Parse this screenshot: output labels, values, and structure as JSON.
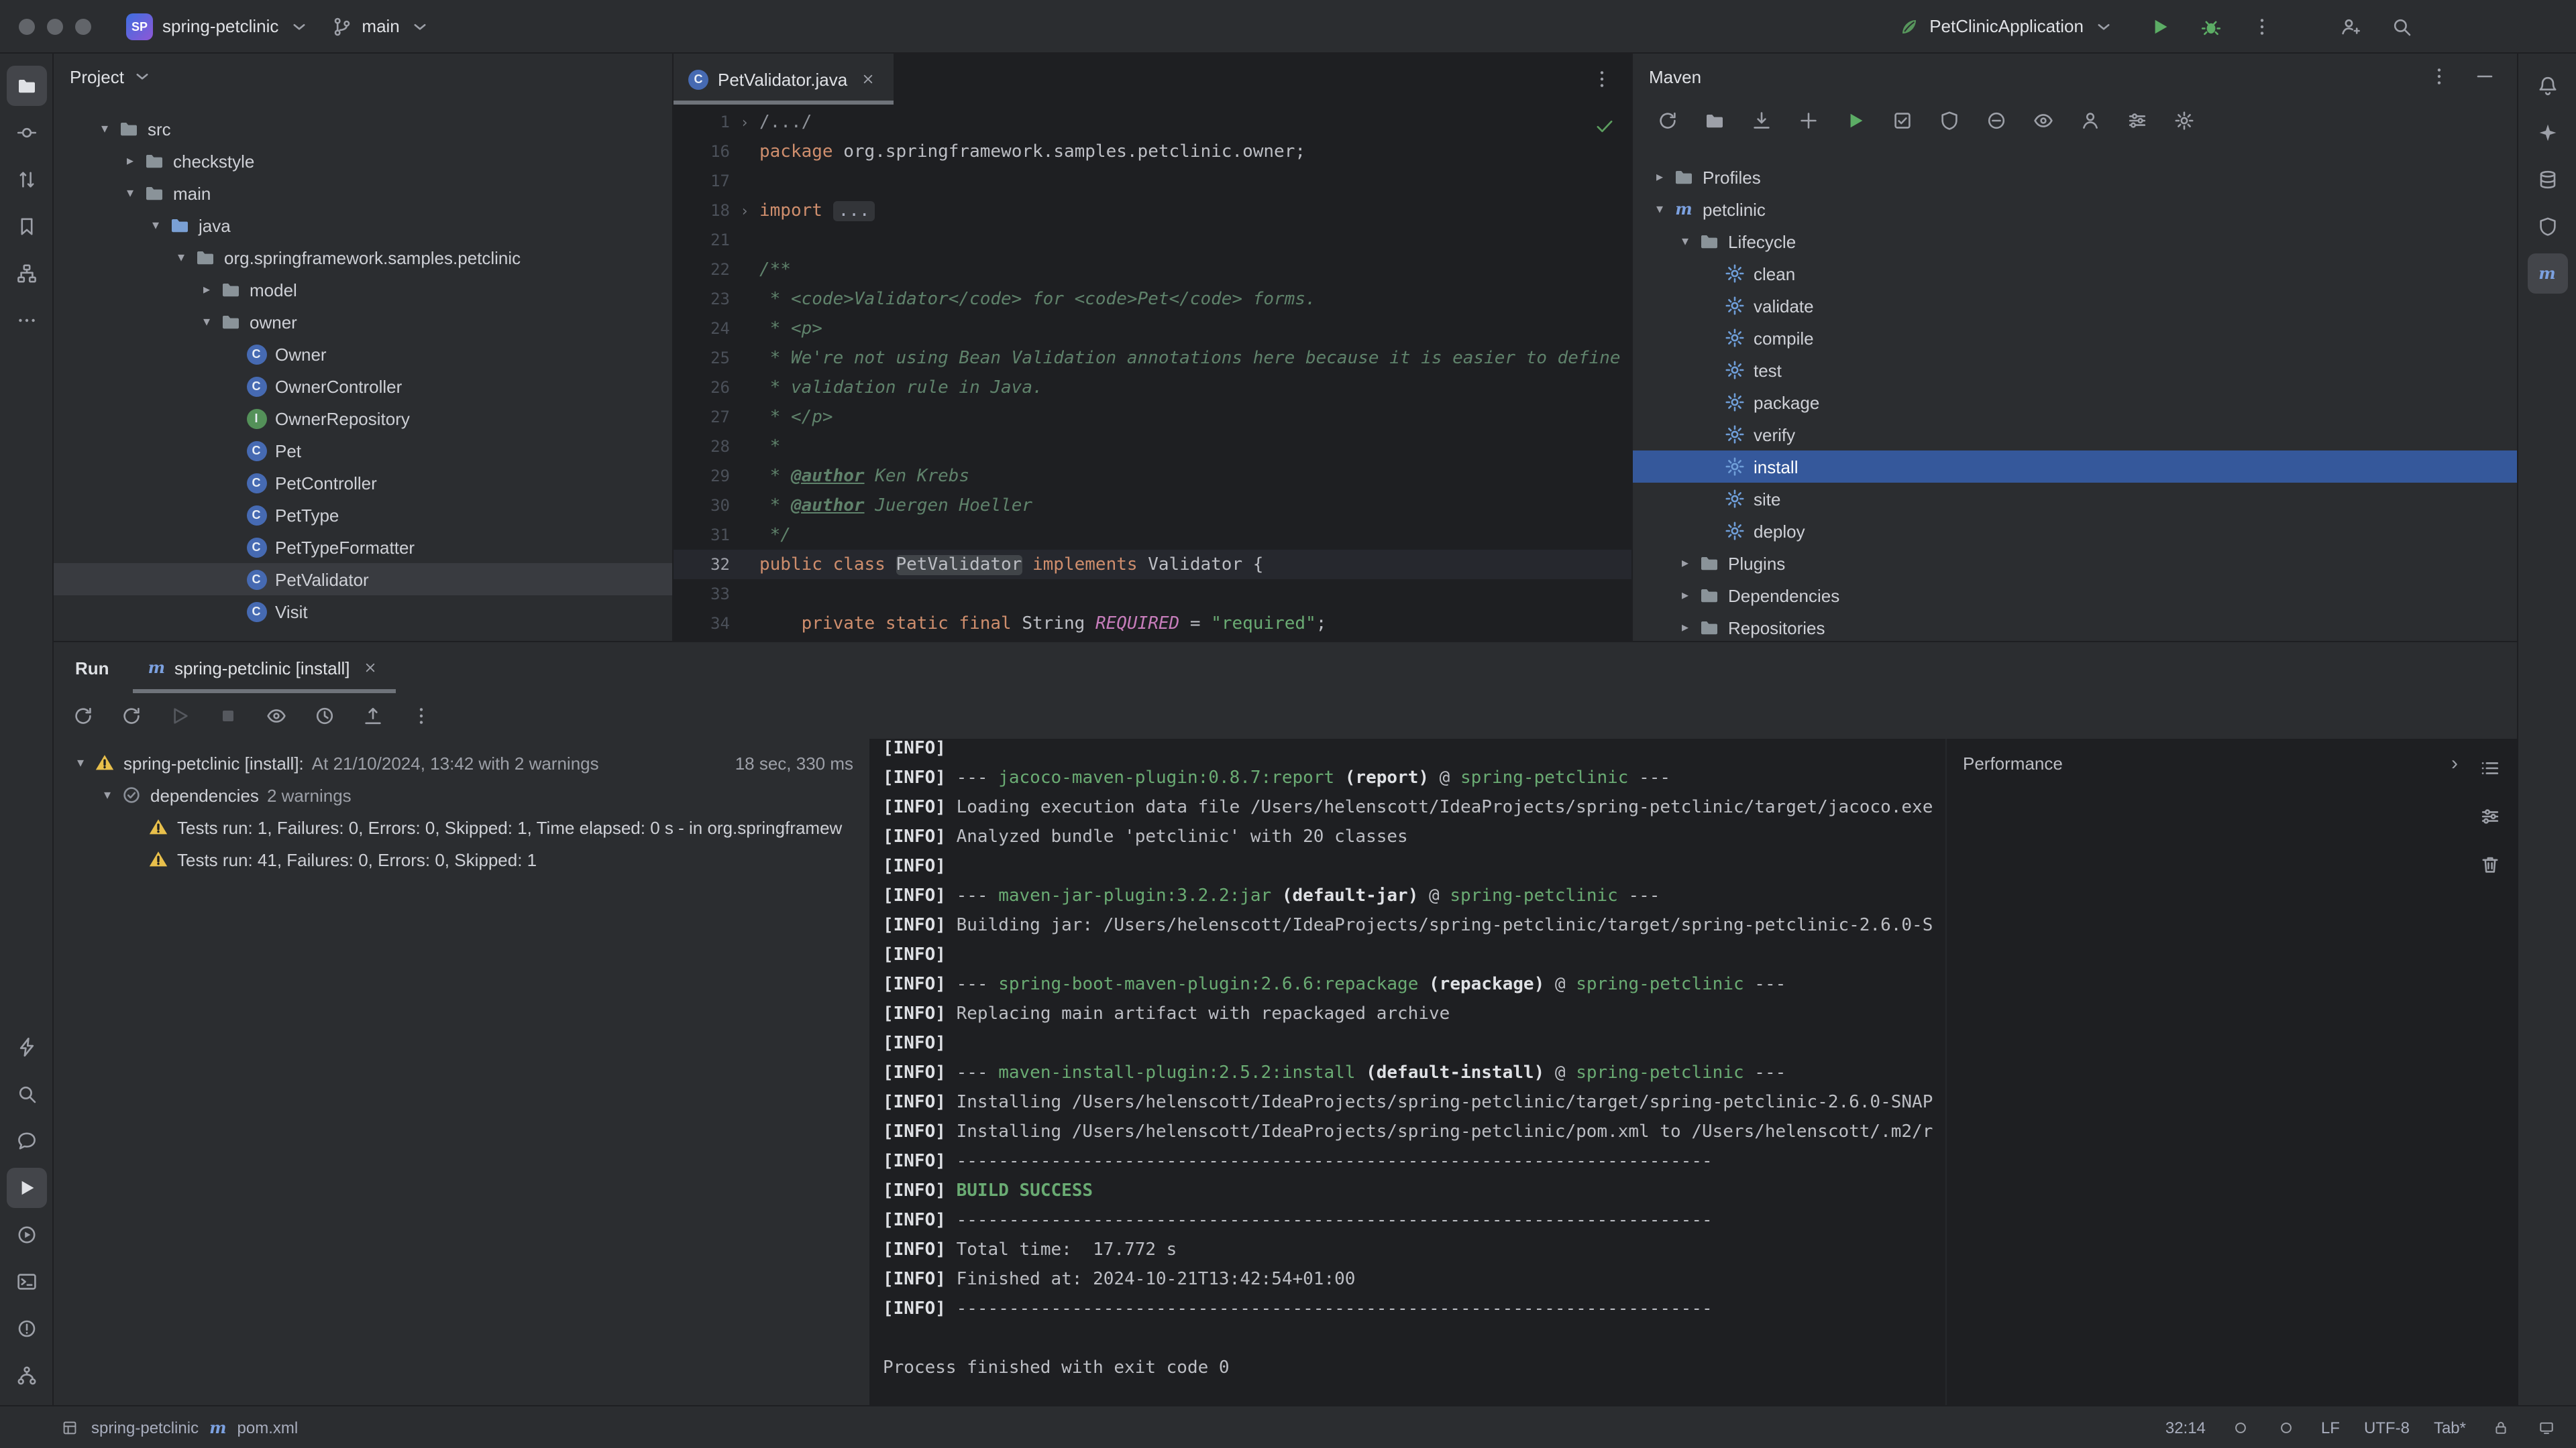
{
  "titlebar": {
    "project_badge": "SP",
    "project_name": "spring-petclinic",
    "branch": "main",
    "run_config": "PetClinicApplication"
  },
  "left_stripe": {
    "top": [
      {
        "icon": "folder",
        "name": "project",
        "active": true
      },
      {
        "icon": "commit",
        "name": "commit"
      },
      {
        "icon": "pull-request",
        "name": "pull-requests"
      },
      {
        "icon": "bookmark",
        "name": "bookmarks"
      },
      {
        "icon": "structure",
        "name": "structure"
      },
      {
        "icon": "dots-h",
        "name": "more-tool-windows"
      }
    ],
    "bottom": [
      {
        "icon": "zap",
        "name": "quick-launch"
      },
      {
        "icon": "search",
        "name": "find"
      },
      {
        "icon": "chat",
        "name": "ai-chat"
      },
      {
        "icon": "run-play",
        "name": "run",
        "active": true
      },
      {
        "icon": "services",
        "name": "services"
      },
      {
        "icon": "terminal",
        "name": "terminal"
      },
      {
        "icon": "problems",
        "name": "problems"
      },
      {
        "icon": "git",
        "name": "version-control"
      }
    ]
  },
  "right_stripe": [
    {
      "icon": "bell",
      "name": "notifications"
    },
    {
      "icon": "sparkle",
      "name": "ai-assistant"
    },
    {
      "icon": "database",
      "name": "database"
    },
    {
      "icon": "shield",
      "name": "coverage"
    },
    {
      "icon": "maven-m",
      "name": "maven",
      "active": true
    }
  ],
  "project_panel": {
    "title": "Project",
    "tree": [
      {
        "label": "src",
        "depth": 0,
        "icon": "folder",
        "chev": "open"
      },
      {
        "label": "checkstyle",
        "depth": 1,
        "icon": "folder",
        "chev": "closed"
      },
      {
        "label": "main",
        "depth": 1,
        "icon": "folder",
        "chev": "open"
      },
      {
        "label": "java",
        "depth": 2,
        "icon": "folder-src",
        "chev": "open"
      },
      {
        "label": "org.springframework.samples.petclinic",
        "depth": 3,
        "icon": "package",
        "chev": "open"
      },
      {
        "label": "model",
        "depth": 4,
        "icon": "package",
        "chev": "closed"
      },
      {
        "label": "owner",
        "depth": 4,
        "icon": "package",
        "chev": "open"
      },
      {
        "label": "Owner",
        "depth": 5,
        "icon": "class"
      },
      {
        "label": "OwnerController",
        "depth": 5,
        "icon": "class"
      },
      {
        "label": "OwnerRepository",
        "depth": 5,
        "icon": "interface"
      },
      {
        "label": "Pet",
        "depth": 5,
        "icon": "class"
      },
      {
        "label": "PetController",
        "depth": 5,
        "icon": "class"
      },
      {
        "label": "PetType",
        "depth": 5,
        "icon": "class"
      },
      {
        "label": "PetTypeFormatter",
        "depth": 5,
        "icon": "class"
      },
      {
        "label": "PetValidator",
        "depth": 5,
        "icon": "class",
        "selected": true
      },
      {
        "label": "Visit",
        "depth": 5,
        "icon": "class"
      }
    ]
  },
  "editor": {
    "tab": "PetValidator.java",
    "lines": [
      {
        "n": "1",
        "fold": true,
        "seg": [
          [
            "/.../",
            "foldtxt"
          ]
        ]
      },
      {
        "n": "16",
        "seg": [
          [
            "package ",
            "kw"
          ],
          [
            "org.springframework.samples.petclinic.owner;",
            "p"
          ]
        ]
      },
      {
        "n": "17",
        "seg": []
      },
      {
        "n": "18",
        "fold": true,
        "seg": [
          [
            "import ",
            "kw"
          ],
          [
            "...",
            "foldbox"
          ]
        ]
      },
      {
        "n": "21",
        "seg": []
      },
      {
        "n": "22",
        "seg": [
          [
            "/**",
            "doc"
          ]
        ]
      },
      {
        "n": "23",
        "seg": [
          [
            " * <code>Validator</code> for <code>Pet</code> forms.",
            "doc"
          ]
        ]
      },
      {
        "n": "24",
        "seg": [
          [
            " * <p>",
            "doc"
          ]
        ]
      },
      {
        "n": "25",
        "seg": [
          [
            " * We're not using Bean Validation annotations here because it is easier to define",
            "doc"
          ]
        ]
      },
      {
        "n": "26",
        "seg": [
          [
            " * validation rule in Java.",
            "doc"
          ]
        ]
      },
      {
        "n": "27",
        "seg": [
          [
            " * </p>",
            "doc"
          ]
        ]
      },
      {
        "n": "28",
        "seg": [
          [
            " *",
            "doc"
          ]
        ]
      },
      {
        "n": "29",
        "seg": [
          [
            " * ",
            "doc"
          ],
          [
            "@author",
            "doctag"
          ],
          [
            " Ken Krebs",
            "doc"
          ]
        ]
      },
      {
        "n": "30",
        "seg": [
          [
            " * ",
            "doc"
          ],
          [
            "@author",
            "doctag"
          ],
          [
            " Juergen Hoeller",
            "doc"
          ]
        ]
      },
      {
        "n": "31",
        "seg": [
          [
            " */",
            "doc"
          ]
        ]
      },
      {
        "n": "32",
        "cur": true,
        "seg": [
          [
            "public class ",
            "kw"
          ],
          [
            "PetValidator",
            "caret"
          ],
          [
            " ",
            "p"
          ],
          [
            "implements",
            "kw"
          ],
          [
            " Validator {",
            "p"
          ]
        ]
      },
      {
        "n": "33",
        "seg": []
      },
      {
        "n": "34",
        "seg": [
          [
            "    ",
            "p"
          ],
          [
            "private static final ",
            "kw"
          ],
          [
            "String ",
            "p"
          ],
          [
            "REQUIRED",
            "const"
          ],
          [
            " = ",
            "p"
          ],
          [
            "\"required\"",
            "str"
          ],
          [
            ";",
            "p"
          ]
        ]
      }
    ]
  },
  "maven_panel": {
    "title": "Maven",
    "toolbar": [
      {
        "icon": "refresh",
        "name": "reload-all-maven-projects"
      },
      {
        "icon": "folder",
        "name": "generate-sources"
      },
      {
        "icon": "download",
        "name": "download-sources"
      },
      {
        "icon": "plus",
        "name": "add-maven-project"
      },
      {
        "icon": "run-play",
        "name": "run-maven-goal",
        "cls": "green"
      },
      {
        "icon": "box",
        "name": "execute-maven-goal"
      },
      {
        "icon": "shield",
        "name": "toggle-offline-mode"
      },
      {
        "icon": "skip",
        "name": "skip-tests-mode"
      },
      {
        "icon": "eye",
        "name": "show-ignored-projects"
      },
      {
        "icon": "person",
        "name": "maven-profiles"
      },
      {
        "icon": "sliders",
        "name": "maven-filter"
      },
      {
        "icon": "gear",
        "name": "maven-settings"
      }
    ],
    "tree": [
      {
        "label": "Profiles",
        "depth": 0,
        "icon": "folder",
        "chev": "closed"
      },
      {
        "label": "petclinic",
        "depth": 0,
        "icon": "maven",
        "chev": "open"
      },
      {
        "label": "Lifecycle",
        "depth": 1,
        "icon": "folder",
        "chev": "open"
      },
      {
        "label": "clean",
        "depth": 2,
        "icon": "goal"
      },
      {
        "label": "validate",
        "depth": 2,
        "icon": "goal"
      },
      {
        "label": "compile",
        "depth": 2,
        "icon": "goal"
      },
      {
        "label": "test",
        "depth": 2,
        "icon": "goal"
      },
      {
        "label": "package",
        "depth": 2,
        "icon": "goal"
      },
      {
        "label": "verify",
        "depth": 2,
        "icon": "goal"
      },
      {
        "label": "install",
        "depth": 2,
        "icon": "goal",
        "selected": true
      },
      {
        "label": "site",
        "depth": 2,
        "icon": "goal"
      },
      {
        "label": "deploy",
        "depth": 2,
        "icon": "goal"
      },
      {
        "label": "Plugins",
        "depth": 1,
        "icon": "folder",
        "chev": "closed"
      },
      {
        "label": "Dependencies",
        "depth": 1,
        "icon": "folder",
        "chev": "closed"
      },
      {
        "label": "Repositories",
        "depth": 1,
        "icon": "folder",
        "chev": "closed"
      }
    ]
  },
  "run_panel": {
    "title": "Run",
    "tab_label": "spring-petclinic [install]",
    "toolbar": [
      {
        "icon": "refresh",
        "name": "rerun"
      },
      {
        "icon": "refresh",
        "name": "rerun-failed-tests"
      },
      {
        "icon": "play-o",
        "name": "resume",
        "disabled": true
      },
      {
        "icon": "stop",
        "name": "stop",
        "cls": "red",
        "disabled": true
      },
      {
        "icon": "eye",
        "name": "show-passed"
      },
      {
        "icon": "clock",
        "name": "test-history"
      },
      {
        "icon": "export",
        "name": "export-test-results"
      },
      {
        "icon": "dots-v",
        "name": "more-options"
      }
    ],
    "tree": [
      {
        "depth": 0,
        "chev": "open",
        "icon": "warning",
        "label": "spring-petclinic [install]:",
        "sub": "At 21/10/2024, 13:42 with 2 warnings",
        "right": "18 sec, 330 ms"
      },
      {
        "depth": 1,
        "chev": "open",
        "icon": "suite",
        "label": "dependencies",
        "sub": "2 warnings"
      },
      {
        "depth": 2,
        "icon": "warning",
        "label": "Tests run: 1, Failures: 0, Errors: 0, Skipped: 1, Time elapsed: 0 s - in org.springframew"
      },
      {
        "depth": 2,
        "icon": "warning",
        "label": "Tests run: 41, Failures: 0, Errors: 0, Skipped: 1"
      }
    ],
    "console": [
      [
        [
          "[INFO]",
          "b"
        ]
      ],
      [
        [
          "[INFO] ",
          "b"
        ],
        [
          "--- ",
          "p"
        ],
        [
          "jacoco-maven-plugin:0.8.7:report",
          "g"
        ],
        [
          " ",
          "p"
        ],
        [
          "(report)",
          "b"
        ],
        [
          " @ ",
          "p"
        ],
        [
          "spring-petclinic",
          "g"
        ],
        [
          " ---",
          "p"
        ]
      ],
      [
        [
          "[INFO] ",
          "b"
        ],
        [
          "Loading execution data file /Users/helenscott/IdeaProjects/spring-petclinic/target/jacoco.exe",
          "p"
        ]
      ],
      [
        [
          "[INFO] ",
          "b"
        ],
        [
          "Analyzed bundle 'petclinic' with 20 classes",
          "p"
        ]
      ],
      [
        [
          "[INFO]",
          "b"
        ]
      ],
      [
        [
          "[INFO] ",
          "b"
        ],
        [
          "--- ",
          "p"
        ],
        [
          "maven-jar-plugin:3.2.2:jar",
          "g"
        ],
        [
          " ",
          "p"
        ],
        [
          "(default-jar)",
          "b"
        ],
        [
          " @ ",
          "p"
        ],
        [
          "spring-petclinic",
          "g"
        ],
        [
          " ---",
          "p"
        ]
      ],
      [
        [
          "[INFO] ",
          "b"
        ],
        [
          "Building jar: /Users/helenscott/IdeaProjects/spring-petclinic/target/spring-petclinic-2.6.0-S",
          "p"
        ]
      ],
      [
        [
          "[INFO]",
          "b"
        ]
      ],
      [
        [
          "[INFO] ",
          "b"
        ],
        [
          "--- ",
          "p"
        ],
        [
          "spring-boot-maven-plugin:2.6.6:repackage",
          "g"
        ],
        [
          " ",
          "p"
        ],
        [
          "(repackage)",
          "b"
        ],
        [
          " @ ",
          "p"
        ],
        [
          "spring-petclinic",
          "g"
        ],
        [
          " ---",
          "p"
        ]
      ],
      [
        [
          "[INFO] ",
          "b"
        ],
        [
          "Replacing main artifact with repackaged archive",
          "p"
        ]
      ],
      [
        [
          "[INFO]",
          "b"
        ]
      ],
      [
        [
          "[INFO] ",
          "b"
        ],
        [
          "--- ",
          "p"
        ],
        [
          "maven-install-plugin:2.5.2:install",
          "g"
        ],
        [
          " ",
          "p"
        ],
        [
          "(default-install)",
          "b"
        ],
        [
          " @ ",
          "p"
        ],
        [
          "spring-petclinic",
          "g"
        ],
        [
          " ---",
          "p"
        ]
      ],
      [
        [
          "[INFO] ",
          "b"
        ],
        [
          "Installing /Users/helenscott/IdeaProjects/spring-petclinic/target/spring-petclinic-2.6.0-SNAP",
          "p"
        ]
      ],
      [
        [
          "[INFO] ",
          "b"
        ],
        [
          "Installing /Users/helenscott/IdeaProjects/spring-petclinic/pom.xml to /Users/helenscott/.m2/r",
          "p"
        ]
      ],
      [
        [
          "[INFO] ",
          "b"
        ],
        [
          "------------------------------------------------------------------------",
          "p"
        ]
      ],
      [
        [
          "[INFO] ",
          "b"
        ],
        [
          "BUILD SUCCESS",
          "gb"
        ]
      ],
      [
        [
          "[INFO] ",
          "b"
        ],
        [
          "------------------------------------------------------------------------",
          "p"
        ]
      ],
      [
        [
          "[INFO] ",
          "b"
        ],
        [
          "Total time:  17.772 s",
          "p"
        ]
      ],
      [
        [
          "[INFO] ",
          "b"
        ],
        [
          "Finished at: 2024-10-21T13:42:54+01:00",
          "p"
        ]
      ],
      [
        [
          "[INFO] ",
          "b"
        ],
        [
          "------------------------------------------------------------------------",
          "p"
        ]
      ],
      [],
      [
        [
          "Process finished with exit code 0",
          "p"
        ]
      ]
    ],
    "performance_title": "Performance",
    "perf_tools": [
      {
        "icon": "list",
        "name": "performance-list"
      },
      {
        "icon": "sliders",
        "name": "performance-settings"
      },
      {
        "icon": "trash",
        "name": "performance-clear"
      }
    ]
  },
  "statusbar": {
    "project": "spring-petclinic",
    "file": "pom.xml",
    "caret": "32:14",
    "line_ending": "LF",
    "encoding": "UTF-8",
    "indent": "Tab*"
  }
}
